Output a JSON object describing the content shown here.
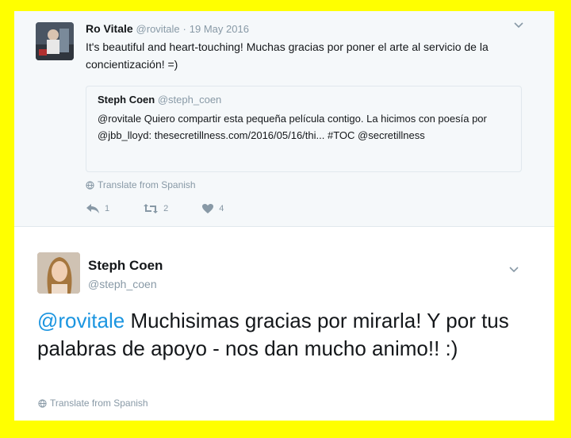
{
  "reply_tweet": {
    "name": "Ro Vitale",
    "handle": "@rovitale",
    "separator": "·",
    "date": "19 May 2016",
    "text": "It's beautiful and heart-touching! Muchas gracias por poner el arte al servicio de la concientización! =)",
    "quoted": {
      "name": "Steph Coen",
      "handle": "@steph_coen",
      "text": "@rovitale Quiero compartir esta pequeña película contigo. La hicimos con poesía por @jbb_lloyd: thesecretillness.com/2016/05/16/thi... #TOC @secretillness"
    },
    "translate_label": "Translate from Spanish",
    "reply_count": "1",
    "retweet_count": "2",
    "like_count": "4",
    "icons": [
      "reply-icon",
      "retweet-icon",
      "heart-icon",
      "globe-icon",
      "chevron-down-icon"
    ]
  },
  "main_tweet": {
    "name": "Steph Coen",
    "handle": "@steph_coen",
    "mention": "@rovitale",
    "text": " Muchisimas gracias por mirarla! Y por tus palabras de apoyo - nos dan mucho animo!! :)",
    "translate_label": "Translate from Spanish"
  },
  "colors": {
    "border": "#ffff00",
    "link": "#1b95e0",
    "muted": "#8899a6"
  }
}
